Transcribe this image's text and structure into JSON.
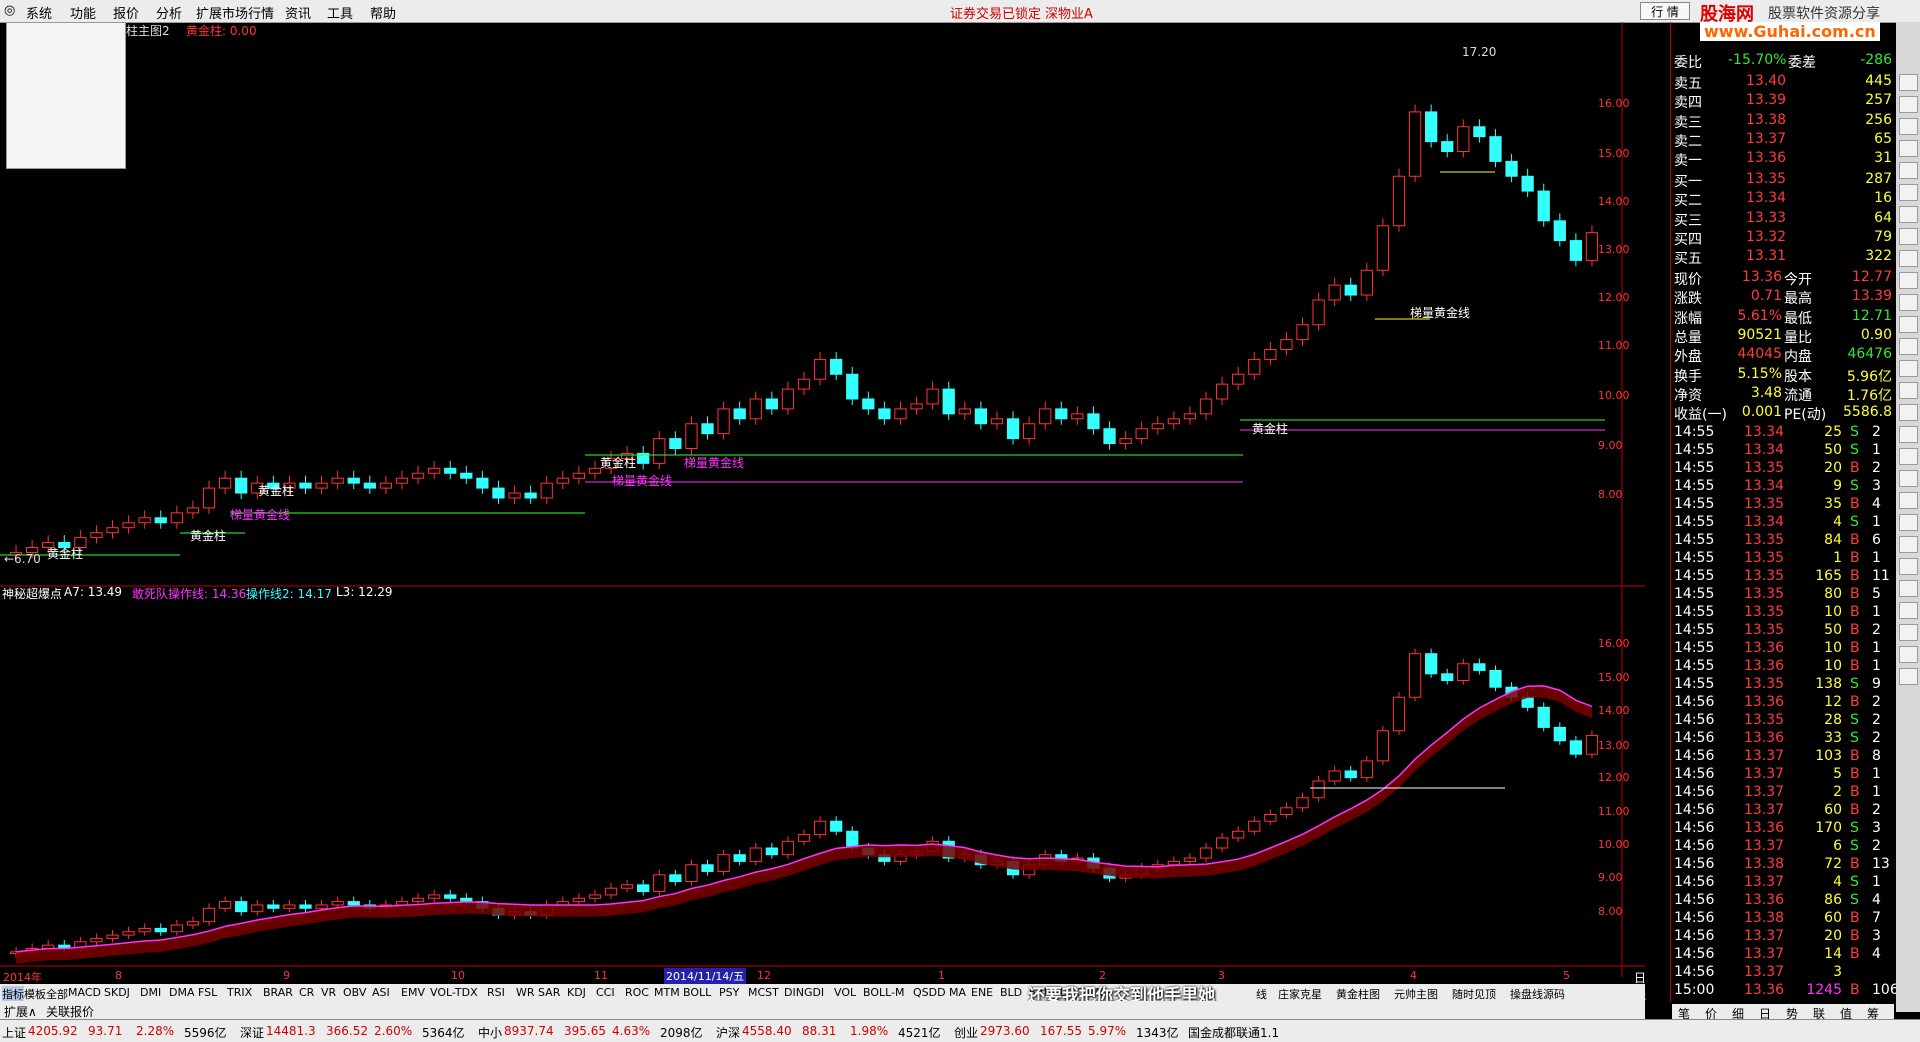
{
  "menu": [
    "系统",
    "功能",
    "报价",
    "分析",
    "扩展市场行情",
    "资讯",
    "工具",
    "帮助"
  ],
  "banner": {
    "locked": "证券交易已锁定",
    "stock": "深物业A",
    "quote_btn": "行 情"
  },
  "logo": {
    "brand": "股海网",
    "slogan": "股票软件资源分享",
    "url": "www.Guhai.com.cn"
  },
  "main_chart": {
    "title_suffix": "柱主图2",
    "gold_bar_label": "黄金柱: 0.00",
    "y_ticks": [
      "17.20",
      "16.00",
      "15.00",
      "14.00",
      "13.00",
      "12.00",
      "11.00",
      "10.00",
      "9.00",
      "8.00"
    ],
    "low_label": "←6.70",
    "annotations": [
      "黄金柱",
      "黄金柱",
      "黄金柱",
      "黄金柱",
      "黄金柱",
      "梯量黄金线",
      "梯量黄金线",
      "梯量黄金线",
      "梯量黄金线"
    ]
  },
  "sub_chart": {
    "title": "神秘超爆点",
    "a7": "A7: 13.49",
    "dare": "敢死队操作线: 14.36",
    "op2": "操作线2: 14.17",
    "l3": "L3: 12.29",
    "y_ticks": [
      "16.00",
      "15.00",
      "14.00",
      "13.00",
      "12.00",
      "11.00",
      "10.00",
      "9.00",
      "8.00"
    ],
    "x_labels": [
      "2014年",
      "8",
      "9",
      "10",
      "11",
      "2014/11/14/五",
      "12",
      "1",
      "2",
      "3",
      "4",
      "5"
    ]
  },
  "chart_data": {
    "type": "candlestick",
    "ylim": [
      6.5,
      17.5
    ],
    "closes": [
      6.9,
      7.0,
      7.1,
      7.0,
      7.2,
      7.3,
      7.4,
      7.5,
      7.6,
      7.5,
      7.7,
      7.8,
      8.2,
      8.4,
      8.1,
      8.3,
      8.2,
      8.3,
      8.2,
      8.3,
      8.4,
      8.3,
      8.2,
      8.3,
      8.4,
      8.5,
      8.6,
      8.5,
      8.4,
      8.2,
      8.0,
      8.1,
      8.0,
      8.3,
      8.4,
      8.5,
      8.6,
      8.8,
      8.9,
      8.7,
      9.2,
      9.0,
      9.5,
      9.3,
      9.8,
      9.6,
      10.0,
      9.8,
      10.2,
      10.4,
      10.8,
      10.5,
      10.0,
      9.8,
      9.6,
      9.8,
      9.9,
      10.2,
      9.7,
      9.8,
      9.5,
      9.6,
      9.2,
      9.5,
      9.8,
      9.6,
      9.7,
      9.4,
      9.1,
      9.2,
      9.4,
      9.5,
      9.6,
      9.7,
      10.0,
      10.3,
      10.5,
      10.8,
      11.0,
      11.2,
      11.5,
      12.0,
      12.3,
      12.1,
      12.6,
      13.5,
      14.5,
      15.8,
      15.2,
      15.0,
      15.5,
      15.3,
      14.8,
      14.5,
      14.2,
      13.6,
      13.2,
      12.8,
      13.36
    ]
  },
  "tabs": [
    "指标",
    "模板",
    "全部",
    "MACD",
    "SKDJ",
    "DMI",
    "DMA",
    "FSL",
    "TRIX",
    "BRAR",
    "CR",
    "VR",
    "OBV",
    "ASI",
    "EMV",
    "VOL-TDX",
    "RSI",
    "WR",
    "SAR",
    "KDJ",
    "CCI",
    "ROC",
    "MTM",
    "BOLL",
    "PSY",
    "MCST",
    "DINGDI",
    "VOL",
    "BOLL-M",
    "QSDD",
    "MA",
    "ENE",
    "BLD",
    "5RBOLL-OWN"
  ],
  "tabs_right": [
    "线",
    "庄家克星",
    "黄金柱图",
    "元帅主图",
    "随时见顶",
    "操盘线源码"
  ],
  "period": "日线",
  "subtitle_overlay": "还要我把你交到他手里她",
  "bottom_tabs": [
    "扩展∧",
    "关联报价"
  ],
  "quote": {
    "ratio": {
      "label": "委比",
      "value": "-15.70%",
      "label2": "委差",
      "value2": "-286"
    },
    "sells": [
      [
        "卖五",
        "13.40",
        "445"
      ],
      [
        "卖四",
        "13.39",
        "257"
      ],
      [
        "卖三",
        "13.38",
        "256"
      ],
      [
        "卖二",
        "13.37",
        "65"
      ],
      [
        "卖一",
        "13.36",
        "31"
      ]
    ],
    "buys": [
      [
        "买一",
        "13.35",
        "287"
      ],
      [
        "买二",
        "13.34",
        "16"
      ],
      [
        "买三",
        "13.33",
        "64"
      ],
      [
        "买四",
        "13.32",
        "79"
      ],
      [
        "买五",
        "13.31",
        "322"
      ]
    ],
    "stats": [
      [
        "现价",
        "13.36",
        "今开",
        "12.77"
      ],
      [
        "涨跌",
        "0.71",
        "最高",
        "13.39"
      ],
      [
        "涨幅",
        "5.61%",
        "最低",
        "12.71"
      ],
      [
        "总量",
        "90521",
        "量比",
        "0.90"
      ],
      [
        "外盘",
        "44045",
        "内盘",
        "46476"
      ],
      [
        "换手",
        "5.15%",
        "股本",
        "5.96亿"
      ],
      [
        "净资",
        "3.48",
        "流通",
        "1.76亿"
      ],
      [
        "收益(一)",
        "0.001",
        "PE(动)",
        "5586.8"
      ]
    ],
    "ticks": [
      [
        "14:55",
        "13.34",
        "25",
        "S",
        "2"
      ],
      [
        "14:55",
        "13.34",
        "50",
        "S",
        "1"
      ],
      [
        "14:55",
        "13.35",
        "20",
        "B",
        "2"
      ],
      [
        "14:55",
        "13.34",
        "9",
        "S",
        "3"
      ],
      [
        "14:55",
        "13.35",
        "35",
        "B",
        "4"
      ],
      [
        "14:55",
        "13.34",
        "4",
        "S",
        "1"
      ],
      [
        "14:55",
        "13.35",
        "84",
        "B",
        "6"
      ],
      [
        "14:55",
        "13.35",
        "1",
        "B",
        "1"
      ],
      [
        "14:55",
        "13.35",
        "165",
        "B",
        "11"
      ],
      [
        "14:55",
        "13.35",
        "80",
        "B",
        "5"
      ],
      [
        "14:55",
        "13.35",
        "10",
        "B",
        "1"
      ],
      [
        "14:55",
        "13.35",
        "50",
        "B",
        "2"
      ],
      [
        "14:55",
        "13.36",
        "10",
        "B",
        "1"
      ],
      [
        "14:55",
        "13.36",
        "10",
        "B",
        "1"
      ],
      [
        "14:55",
        "13.35",
        "138",
        "S",
        "9"
      ],
      [
        "14:56",
        "13.36",
        "12",
        "B",
        "2"
      ],
      [
        "14:56",
        "13.35",
        "28",
        "S",
        "2"
      ],
      [
        "14:56",
        "13.36",
        "33",
        "S",
        "2"
      ],
      [
        "14:56",
        "13.37",
        "103",
        "B",
        "8"
      ],
      [
        "14:56",
        "13.37",
        "5",
        "B",
        "1"
      ],
      [
        "14:56",
        "13.37",
        "2",
        "B",
        "1"
      ],
      [
        "14:56",
        "13.37",
        "60",
        "B",
        "2"
      ],
      [
        "14:56",
        "13.36",
        "170",
        "S",
        "3"
      ],
      [
        "14:56",
        "13.37",
        "6",
        "S",
        "2"
      ],
      [
        "14:56",
        "13.38",
        "72",
        "B",
        "13"
      ],
      [
        "14:56",
        "13.37",
        "4",
        "S",
        "1"
      ],
      [
        "14:56",
        "13.36",
        "86",
        "S",
        "4"
      ],
      [
        "14:56",
        "13.38",
        "60",
        "B",
        "7"
      ],
      [
        "14:56",
        "13.37",
        "20",
        "B",
        "3"
      ],
      [
        "14:56",
        "13.37",
        "14",
        "B",
        "4"
      ],
      [
        "14:56",
        "13.37",
        "3",
        "",
        ""
      ],
      [
        "15:00",
        "13.36",
        "1245",
        "B",
        "106"
      ]
    ],
    "bottom_tabs": [
      "笔",
      "价",
      "细",
      "日",
      "势",
      "联",
      "值",
      "筹"
    ]
  },
  "status": [
    {
      "label": "上证",
      "price": "4205.92",
      "chg": "93.71",
      "pct": "2.28%",
      "amt": "5596亿"
    },
    {
      "label": "深证",
      "price": "14481.3",
      "chg": "366.52",
      "pct": "2.60%",
      "amt": "5364亿"
    },
    {
      "label": "中小",
      "price": "8937.74",
      "chg": "395.65",
      "pct": "4.63%",
      "amt": "2098亿"
    },
    {
      "label": "沪深",
      "price": "4558.40",
      "chg": "88.31",
      "pct": "1.98%",
      "amt": "4521亿"
    },
    {
      "label": "创业",
      "price": "2973.60",
      "chg": "167.55",
      "pct": "5.97%",
      "amt": "1343亿"
    }
  ],
  "status_right": "国金成都联通1.1",
  "colors": {
    "up": "#ff3333",
    "down": "#33ffff",
    "axis": "#c00000",
    "gold": "#ffff00",
    "magenta": "#ff33ff",
    "green_line": "#33ff33"
  }
}
